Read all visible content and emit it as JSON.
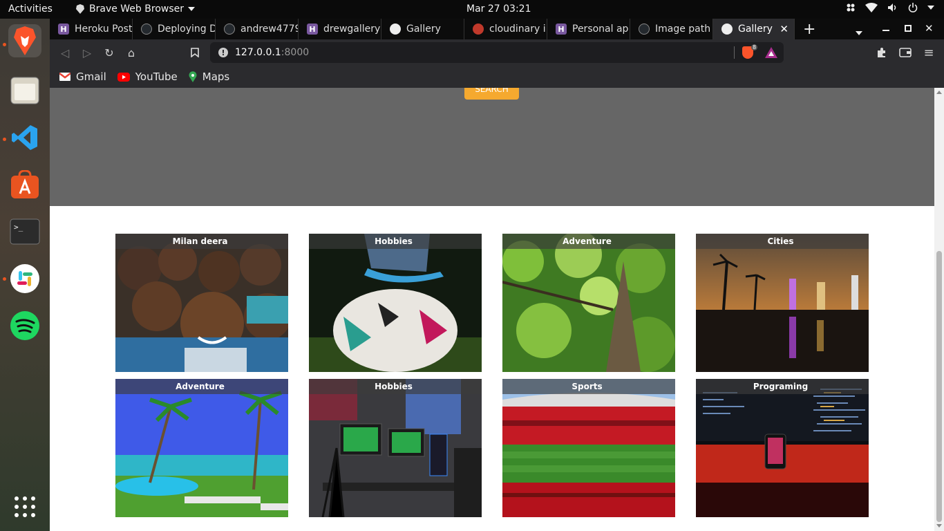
{
  "topbar": {
    "activities": "Activities",
    "app_name": "Brave Web Browser",
    "clock": "Mar 27  03:21"
  },
  "tabs": [
    {
      "label": "Heroku Post",
      "icon": "heroku-icon",
      "color": "#79589f"
    },
    {
      "label": "Deploying D",
      "icon": "github-icon",
      "color": "#24292e"
    },
    {
      "label": "andrew4779",
      "icon": "github-icon",
      "color": "#24292e"
    },
    {
      "label": "drewgallery",
      "icon": "heroku-icon",
      "color": "#79589f"
    },
    {
      "label": "Gallery",
      "icon": "globe-icon",
      "color": "#555"
    },
    {
      "label": "cloudinary i",
      "icon": "cloudinary-icon",
      "color": "#c0392b"
    },
    {
      "label": "Personal ap",
      "icon": "heroku-icon",
      "color": "#79589f"
    },
    {
      "label": "Image path",
      "icon": "github-icon",
      "color": "#24292e"
    },
    {
      "label": "Gallery",
      "icon": "globe-icon",
      "color": "#555",
      "active": true
    }
  ],
  "toolbar": {
    "url_host": "127.0.0.1",
    "url_port": ":8000",
    "shield_count": "8"
  },
  "bookmarks": [
    {
      "label": "Gmail",
      "icon": "gmail-icon"
    },
    {
      "label": "YouTube",
      "icon": "youtube-icon"
    },
    {
      "label": "Maps",
      "icon": "maps-icon"
    }
  ],
  "page": {
    "search_label": "SEARCH",
    "cards": [
      {
        "caption": "Milan deera",
        "scene": "children-photo"
      },
      {
        "caption": "Hobbies",
        "scene": "rugby-ball-photo"
      },
      {
        "caption": "Adventure",
        "scene": "tree-photo"
      },
      {
        "caption": "Cities",
        "scene": "night-city-photo"
      },
      {
        "caption": "Adventure",
        "scene": "beach-resort-photo"
      },
      {
        "caption": "Hobbies",
        "scene": "gaming-setup-photo"
      },
      {
        "caption": "Sports",
        "scene": "stadium-photo"
      },
      {
        "caption": "Programing",
        "scene": "code-screen-photo"
      }
    ]
  },
  "colors": {
    "accent": "#f5a92f",
    "hero": "#666666",
    "ubuntu_orange": "#e95420"
  }
}
